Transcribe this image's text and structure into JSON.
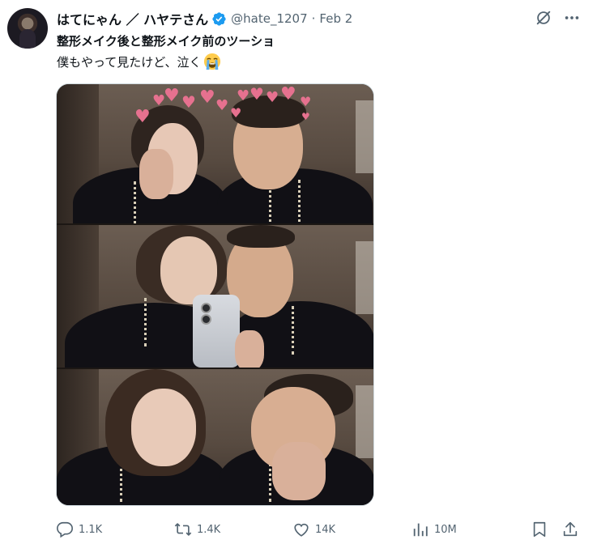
{
  "tweet": {
    "display_name": "はてにゃん ／ ハヤテさん",
    "handle": "@hate_1207",
    "separator": "·",
    "date": "Feb 2",
    "verified": true,
    "text_line1": "整形メイク後と整形メイク前のツーショ",
    "text_line2": "僕もやって見たけど、泣く",
    "emoji": "loudly-crying-face"
  },
  "media": {
    "panels": 3
  },
  "actions": {
    "replies": "1.1K",
    "retweets": "1.4K",
    "likes": "14K",
    "views": "10M"
  },
  "colors": {
    "text": "#0f1419",
    "secondary": "#536471",
    "verified": "#1d9bf0",
    "border": "#cfd9de"
  }
}
